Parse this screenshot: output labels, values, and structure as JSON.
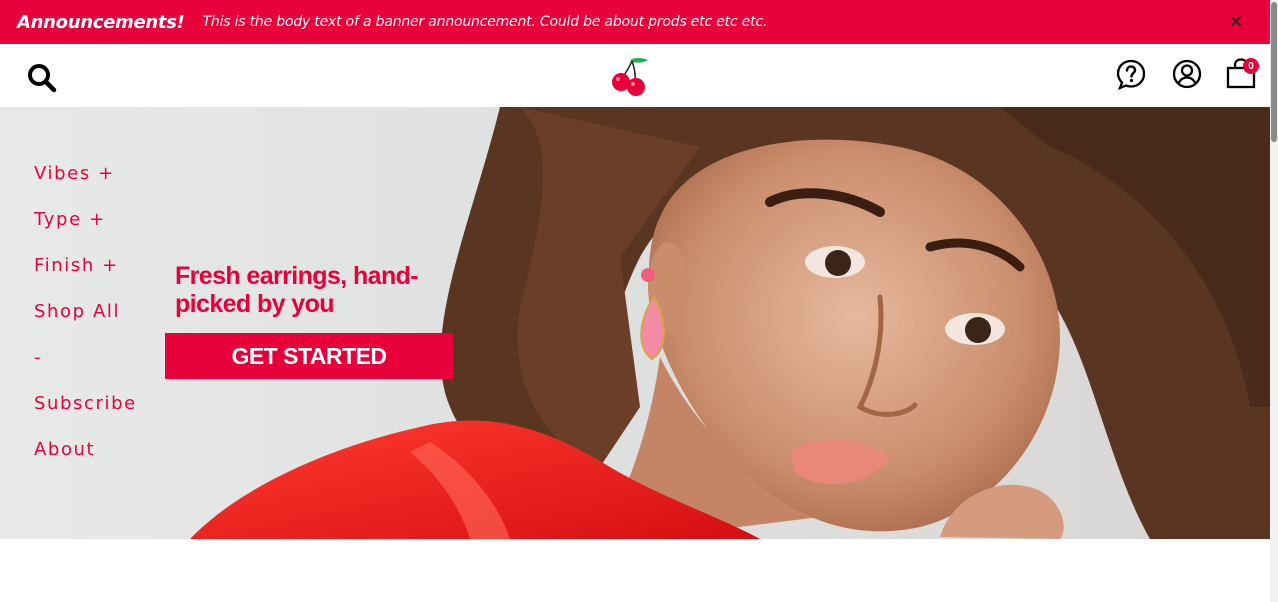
{
  "announcement": {
    "title": "Announcements!",
    "body": "This is the body text of a banner announcement. Could be about prods etc etc etc.",
    "close_icon": "close-icon",
    "background": "#e8003a"
  },
  "header": {
    "search_icon": "search-icon",
    "logo_icon": "cherry-logo-icon",
    "help_icon": "help-icon",
    "account_icon": "account-icon",
    "bag_icon": "shopping-bag-icon",
    "bag_count": "0"
  },
  "side_nav": {
    "items": [
      {
        "label": "Vibes +"
      },
      {
        "label": "Type +"
      },
      {
        "label": "Finish +"
      },
      {
        "label": "Shop All"
      },
      {
        "label": "-"
      },
      {
        "label": "Subscribe"
      },
      {
        "label": "About"
      }
    ]
  },
  "hero": {
    "heading": "Fresh earrings, hand-picked by you",
    "cta_label": "GET STARTED"
  },
  "colors": {
    "brand": "#e8003a"
  }
}
